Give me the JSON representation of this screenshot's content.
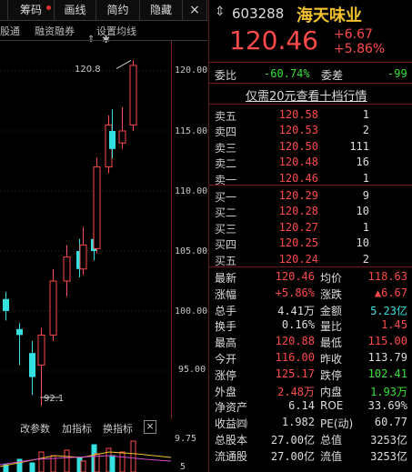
{
  "toolbar": {
    "tabs": [
      "筹码",
      "画线",
      "简约",
      "隐藏"
    ],
    "close_glyph": "×",
    "sub_items": [
      "股通",
      "融资融券",
      "设置均线"
    ],
    "pin_glyph": "⇕",
    "gear_glyph": "✱"
  },
  "chart": {
    "y_axis_labels": [
      "120.00",
      "115.00",
      "110.00",
      "105.00",
      "100.00",
      "95.00"
    ],
    "high_marker": "120.8",
    "low_marker": "92.1",
    "volume_axis_label": "9.75",
    "volume_axis_label_2": "5"
  },
  "chart_data": {
    "type": "candlestick",
    "y_ticks": [
      95,
      100,
      105,
      110,
      115,
      120
    ],
    "candles": [
      {
        "open": 101.0,
        "close": 100.0,
        "high": 101.6,
        "low": 99.2
      },
      {
        "open": 98.5,
        "close": 98.0,
        "high": 99.0,
        "low": 95.5
      },
      {
        "open": 96.5,
        "close": 94.5,
        "high": 97.5,
        "low": 93.0
      },
      {
        "open": 95.5,
        "close": 98.0,
        "high": 98.6,
        "low": 92.1
      },
      {
        "open": 98.0,
        "close": 102.5,
        "high": 103.5,
        "low": 97.5
      },
      {
        "open": 102.5,
        "close": 104.5,
        "high": 105.5,
        "low": 101.2
      },
      {
        "open": 105.0,
        "close": 103.5,
        "high": 106.0,
        "low": 102.8
      },
      {
        "open": 103.5,
        "close": 105.5,
        "high": 107.0,
        "low": 103.0
      },
      {
        "open": 106.0,
        "close": 105.0,
        "high": 106.8,
        "low": 104.2
      },
      {
        "open": 105.2,
        "close": 112.0,
        "high": 112.8,
        "low": 104.8
      },
      {
        "open": 112.0,
        "close": 115.5,
        "high": 116.3,
        "low": 111.5
      },
      {
        "open": 115.0,
        "close": 113.5,
        "high": 116.8,
        "low": 112.7
      },
      {
        "open": 114.0,
        "close": 115.0,
        "high": 117.0,
        "low": 113.5
      },
      {
        "open": 115.5,
        "close": 120.46,
        "high": 120.88,
        "low": 115.0
      }
    ],
    "volume_axis": "9.75"
  },
  "lower": {
    "buttons": [
      "改参数",
      "加指标",
      "换指标"
    ],
    "close_glyph": "×"
  },
  "quote": {
    "code": "603288",
    "name": "海天味业",
    "price": "120.46",
    "change": "+6.67",
    "change_pct": "+5.86%",
    "weibi_label": "委比",
    "weibi": "-60.74%",
    "weicha_label": "委差",
    "weicha": "-99",
    "promo": "仅需20元查看十档行情",
    "asks": [
      {
        "label": "卖五",
        "price": "120.58",
        "vol": "1"
      },
      {
        "label": "卖四",
        "price": "120.53",
        "vol": "2"
      },
      {
        "label": "卖三",
        "price": "120.50",
        "vol": "111"
      },
      {
        "label": "卖二",
        "price": "120.48",
        "vol": "16"
      },
      {
        "label": "卖一",
        "price": "120.46",
        "vol": "1"
      }
    ],
    "bids": [
      {
        "label": "买一",
        "price": "120.29",
        "vol": "9"
      },
      {
        "label": "买二",
        "price": "120.28",
        "vol": "10"
      },
      {
        "label": "买三",
        "price": "120.27",
        "vol": "1"
      },
      {
        "label": "买四",
        "price": "120.25",
        "vol": "10"
      },
      {
        "label": "买五",
        "price": "120.24",
        "vol": "2"
      }
    ],
    "stats": [
      {
        "k1": "最新",
        "v1": "120.46",
        "c1": "red",
        "k2": "均价",
        "v2": "118.63",
        "c2": "red"
      },
      {
        "k1": "涨幅",
        "v1": "+5.86%",
        "c1": "red",
        "k2": "涨跌",
        "v2": "▲6.67",
        "c2": "red"
      },
      {
        "k1": "总手",
        "v1": "4.41万",
        "c1": "wht",
        "k2": "金额",
        "v2": "5.23亿",
        "c2": "cyan"
      },
      {
        "k1": "换手",
        "v1": "0.16%",
        "c1": "wht",
        "k2": "量比",
        "v2": "1.45",
        "c2": "red"
      },
      {
        "k1": "最高",
        "v1": "120.88",
        "c1": "red",
        "k2": "最低",
        "v2": "115.00",
        "c2": "red"
      },
      {
        "k1": "今开",
        "v1": "116.00",
        "c1": "red",
        "k2": "昨收",
        "v2": "113.79",
        "c2": "wht"
      },
      {
        "k1": "涨停",
        "v1": "125.17",
        "c1": "red",
        "k2": "跌停",
        "v2": "102.41",
        "c2": "grn"
      },
      {
        "k1": "外盘",
        "v1": "2.48万",
        "c1": "red",
        "k2": "内盘",
        "v2": "1.93万",
        "c2": "grn"
      },
      {
        "k1": "净资产",
        "v1": "6.14",
        "c1": "wht",
        "k2": "ROE",
        "v2": "33.69%",
        "c2": "wht"
      },
      {
        "k1": "收益㈣",
        "v1": "1.982",
        "c1": "wht",
        "k2": "PE(动)",
        "v2": "60.77",
        "c2": "wht"
      },
      {
        "k1": "总股本",
        "v1": "27.00亿",
        "c1": "wht",
        "k2": "总值",
        "v2": "3253亿",
        "c2": "wht"
      },
      {
        "k1": "流通股",
        "v1": "27.00亿",
        "c1": "wht",
        "k2": "流值",
        "v2": "3253亿",
        "c2": "wht"
      }
    ]
  },
  "colors": {
    "up": "#ff4a4a",
    "down": "#35e0e0",
    "name": "#f2c12e",
    "bg": "#000000"
  }
}
